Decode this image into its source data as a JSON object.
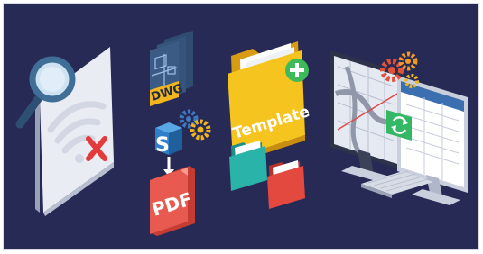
{
  "scene": {
    "background": "#282a56",
    "panels": [
      {
        "name": "document-offline",
        "icons": [
          "magnifier-icon",
          "wifi-off-icon",
          "x-mark-icon"
        ]
      },
      {
        "name": "conversion",
        "icons": [
          "blueprint-sheet-icon",
          "s-cube-icon",
          "gear-icon",
          "arrow-down-icon"
        ]
      },
      {
        "name": "templates",
        "icons": [
          "folder-icon",
          "plus-icon"
        ]
      },
      {
        "name": "workstation",
        "icons": [
          "monitor-icon",
          "map-icon",
          "sync-icon",
          "keyboard-icon"
        ]
      }
    ]
  },
  "labels": {
    "dwg": "DWG",
    "pdf": "PDF",
    "template": "Template",
    "s": "S"
  },
  "colors": {
    "paper": "#e9ecf3",
    "paper_side": "#b8bfd0",
    "magnifier": "#3f6f97",
    "red": "#e33b3b",
    "dwg_sheet": "#3b5b84",
    "dwg_tab": "#f2b51e",
    "s_cube": "#2f7fc9",
    "pdf": "#e85a4f",
    "folder_yellow": "#f6c41f",
    "folder_teal": "#2ab3a9",
    "folder_red": "#e4493f",
    "plus_green": "#3fba5b",
    "gear_orange": "#f29a22",
    "gear_red": "#e2533a",
    "monitor_dark": "#2d3348",
    "monitor_light": "#c9cfdc",
    "sync_green": "#35b865"
  }
}
